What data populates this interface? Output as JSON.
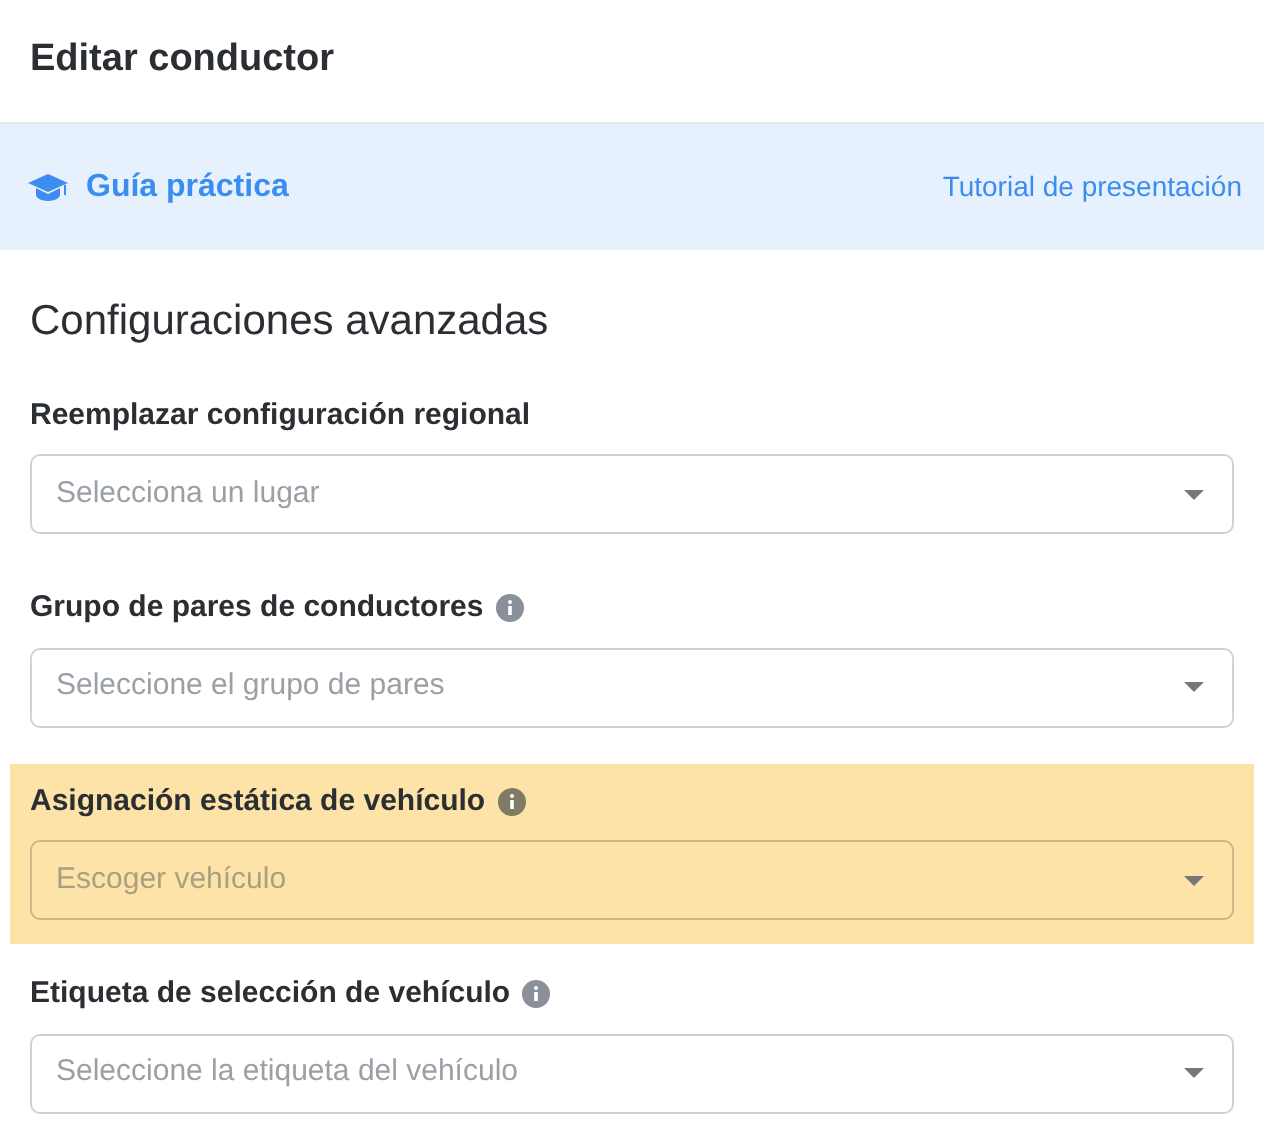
{
  "title": "Editar conductor",
  "guide": {
    "label": "Guía práctica",
    "link": "Tutorial de presentación"
  },
  "section_title": "Configuraciones avanzadas",
  "fields": [
    {
      "label": "Reemplazar configuración regional",
      "info": false,
      "placeholder": "Selecciona un lugar",
      "highlighted": false
    },
    {
      "label": "Grupo de pares de conductores",
      "info": true,
      "placeholder": "Seleccione el grupo de pares",
      "highlighted": false
    },
    {
      "label": "Asignación estática de vehículo",
      "info": true,
      "placeholder": "Escoger vehículo",
      "highlighted": true
    },
    {
      "label": "Etiqueta de selección de vehículo",
      "info": true,
      "placeholder": "Seleccione la etiqueta del vehículo",
      "highlighted": false
    }
  ]
}
